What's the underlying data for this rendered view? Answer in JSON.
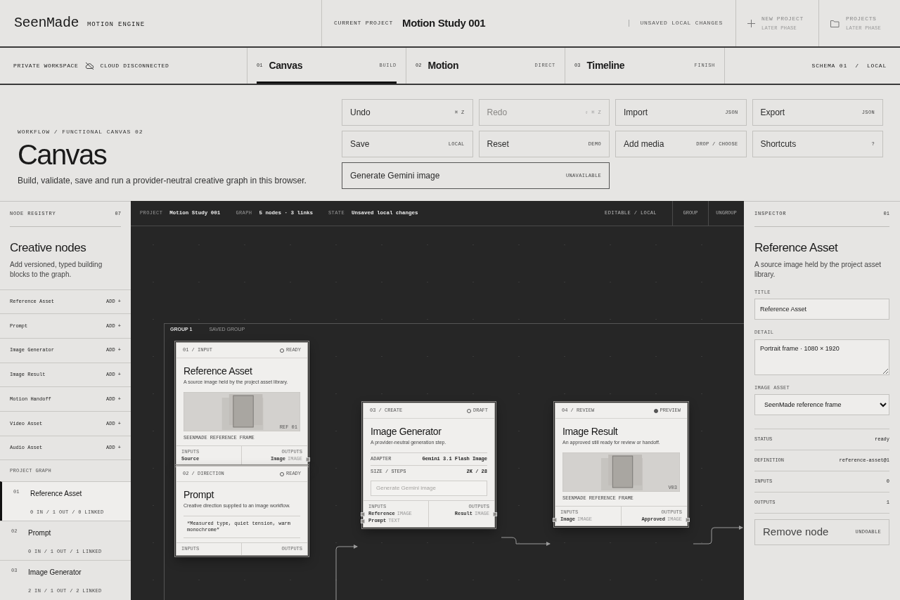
{
  "brand": {
    "name": "SeenMade",
    "tagline": "MOTION ENGINE"
  },
  "current_project": {
    "label": "CURRENT PROJECT",
    "name": "Motion Study 001",
    "state": "UNSAVED LOCAL CHANGES"
  },
  "header_actions": [
    {
      "kind": "plus",
      "title": "NEW PROJECT",
      "note": "LATER PHASE"
    },
    {
      "kind": "folder",
      "title": "PROJECTS",
      "note": "LATER PHASE"
    }
  ],
  "workspace": {
    "label": "PRIVATE WORKSPACE",
    "cloud": "CLOUD DISCONNECTED"
  },
  "tabs": [
    {
      "number": "01",
      "label": "Canvas",
      "tag": "BUILD",
      "selected": true
    },
    {
      "number": "02",
      "label": "Motion",
      "tag": "DIRECT",
      "selected": false
    },
    {
      "number": "03",
      "label": "Timeline",
      "tag": "FINISH",
      "selected": false
    }
  ],
  "schema": "SCHEMA 01  /  LOCAL",
  "hero": {
    "breadcrumb": "WORKFLOW / FUNCTIONAL CANVAS 02",
    "title": "Canvas",
    "description": "Build, validate, save and run a provider-neutral creative graph in this browser."
  },
  "actions": [
    {
      "label": "Undo",
      "hint": "⌘ Z",
      "disabled": false
    },
    {
      "label": "Redo",
      "hint": "⇧ ⌘ Z",
      "disabled": true
    },
    {
      "label": "Import",
      "hint": "JSON",
      "disabled": false
    },
    {
      "label": "Export",
      "hint": "JSON",
      "disabled": false
    },
    {
      "label": "Save",
      "hint": "LOCAL",
      "disabled": false
    },
    {
      "label": "Reset",
      "hint": "DEMO",
      "disabled": false
    },
    {
      "label": "Add media",
      "hint": "DROP / CHOOSE",
      "disabled": false
    },
    {
      "label": "Shortcuts",
      "hint": "?",
      "disabled": false
    }
  ],
  "generate_button": {
    "label": "Generate Gemini image",
    "hint": "UNAVAILABLE"
  },
  "registry": {
    "label": "NODE REGISTRY",
    "count": "07",
    "title": "Creative nodes",
    "description": "Add versioned, typed building blocks to the graph.",
    "items": [
      {
        "name": "Reference Asset",
        "action": "ADD +"
      },
      {
        "name": "Prompt",
        "action": "ADD +"
      },
      {
        "name": "Image Generator",
        "action": "ADD +"
      },
      {
        "name": "Image Result",
        "action": "ADD +"
      },
      {
        "name": "Motion Handoff",
        "action": "ADD +"
      },
      {
        "name": "Video Asset",
        "action": "ADD +"
      },
      {
        "name": "Audio Asset",
        "action": "ADD +"
      }
    ]
  },
  "project_graph": {
    "label": "PROJECT GRAPH",
    "items": [
      {
        "number": "01",
        "name": "Reference Asset",
        "stats": "0 IN / 1 OUT / 0 LINKED",
        "selected": true
      },
      {
        "number": "02",
        "name": "Prompt",
        "stats": "0 IN / 1 OUT / 1 LINKED",
        "selected": false
      },
      {
        "number": "03",
        "name": "Image Generator",
        "stats": "2 IN / 1 OUT / 2 LINKED",
        "selected": false
      }
    ]
  },
  "canvas_bar": {
    "items": [
      {
        "label": "PROJECT",
        "value": "Motion Study 001"
      },
      {
        "label": "GRAPH",
        "value": "5 nodes · 3 links"
      },
      {
        "label": "STATE",
        "value": "Unsaved local changes"
      }
    ],
    "mode": "EDITABLE / LOCAL",
    "buttons": [
      "GROUP",
      "UNGROUP"
    ]
  },
  "group": {
    "name": "GROUP 1",
    "note": "SAVED GROUP"
  },
  "nodes": [
    {
      "step": "01 / INPUT",
      "status": "READY",
      "dot_filled": false,
      "title": "Reference Asset",
      "description": "A source image held by the project asset library.",
      "preview": {
        "tag": "REF 01",
        "caption": "SEENMADE REFERENCE FRAME"
      },
      "inputs_label": "INPUTS",
      "outputs_label": "OUTPUTS",
      "inputs": [
        {
          "name": "Source"
        }
      ],
      "outputs": [
        {
          "name": "Image",
          "type": "IMAGE"
        }
      ]
    },
    {
      "step": "02 / DIRECTION",
      "status": "READY",
      "dot_filled": false,
      "title": "Prompt",
      "description": "Creative direction supplied to an image workflow.",
      "quote": "“Measured type, quiet tension, warm monochrome”",
      "inputs_label": "INPUTS",
      "outputs_label": "OUTPUTS"
    },
    {
      "step": "03 / CREATE",
      "status": "DRAFT",
      "dot_filled": false,
      "title": "Image Generator",
      "description": "A provider-neutral generation step.",
      "fields": [
        {
          "label": "ADAPTER",
          "value": "Gemini 3.1 Flash Image"
        },
        {
          "label": "SIZE / STEPS",
          "value": "2K / 28"
        }
      ],
      "action": "Generate Gemini image",
      "inputs_label": "INPUTS",
      "outputs_label": "OUTPUTS",
      "inputs": [
        {
          "name": "Reference",
          "type": "IMAGE"
        },
        {
          "name": "Prompt",
          "type": "TEXT"
        }
      ],
      "outputs": [
        {
          "name": "Result",
          "type": "IMAGE"
        }
      ]
    },
    {
      "step": "04 / REVIEW",
      "status": "PREVIEW",
      "dot_filled": true,
      "title": "Image Result",
      "description": "An approved still ready for review or handoff.",
      "preview": {
        "tag": "V03",
        "caption": "SEENMADE REFERENCE FRAME"
      },
      "inputs_label": "INPUTS",
      "outputs_label": "OUTPUTS",
      "inputs": [
        {
          "name": "Image",
          "type": "IMAGE"
        }
      ],
      "outputs": [
        {
          "name": "Approved",
          "type": "IMAGE"
        }
      ]
    }
  ],
  "inspector": {
    "label": "INSPECTOR",
    "count": "01",
    "title": "Reference Asset",
    "description": "A source image held by the project asset library.",
    "fields": [
      {
        "kind": "input",
        "label": "TITLE",
        "value": "Reference Asset"
      },
      {
        "kind": "textarea",
        "label": "DETAIL",
        "value": "Portrait frame · 1080 × 1920"
      },
      {
        "kind": "select",
        "label": "IMAGE ASSET",
        "value": "SeenMade reference frame"
      }
    ],
    "stats": [
      {
        "label": "STATUS",
        "value": "ready"
      },
      {
        "label": "DEFINITION",
        "value": "reference-asset@1"
      },
      {
        "label": "INPUTS",
        "value": "0"
      },
      {
        "label": "OUTPUTS",
        "value": "1"
      }
    ],
    "remove": {
      "label": "Remove node",
      "hint": "UNDOABLE"
    }
  }
}
